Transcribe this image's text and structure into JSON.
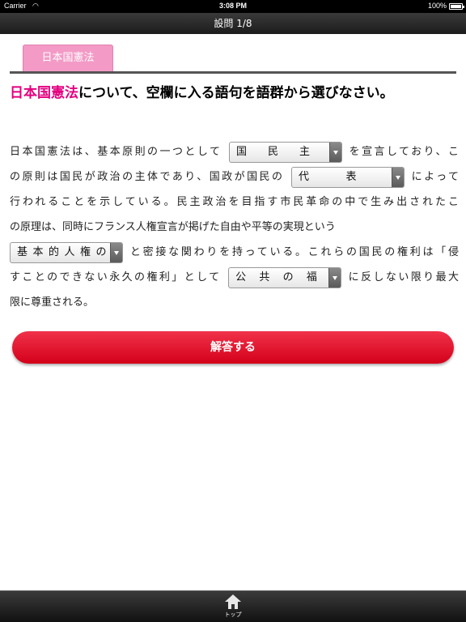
{
  "status_bar": {
    "carrier": "Carrier",
    "time": "3:08 PM",
    "battery": "100%",
    "battery_level": 1.0
  },
  "nav": {
    "title": "設問 1/8"
  },
  "category": {
    "label": "日本国憲法"
  },
  "question": {
    "highlight": "日本国憲法",
    "text": "について、空欄に入る語句を語群から選びなさい。"
  },
  "passage": {
    "line1_a": "日本国憲法は、基本原則の一つとして",
    "blank1": "国民主権",
    "line1_b": "を宣言しており、こ",
    "line2_a": "の原則は国民が政治の主体であり、国政が国民の",
    "blank2": "代表者",
    "line2_b": "によって",
    "line3": "行われることを示している。民主政治を目指す市民革命の中で生み出されたこ",
    "line4": "の原理は、同時にフランス人権宣言が掲げた自由や平等の実現という",
    "blank3": "基本的人権の尊",
    "line5_b": "と密接な関わりを持っている。これらの国民の権利は「侵",
    "line6_a": "すことのできない永久の権利」として",
    "blank4": "公共の福祉",
    "line6_b": "に反しない限り最大",
    "line7": "限に尊重される。"
  },
  "answer_button": {
    "label": "解答する"
  },
  "tab_bar": {
    "top_label": "トップ",
    "top_icon": "home-icon"
  }
}
